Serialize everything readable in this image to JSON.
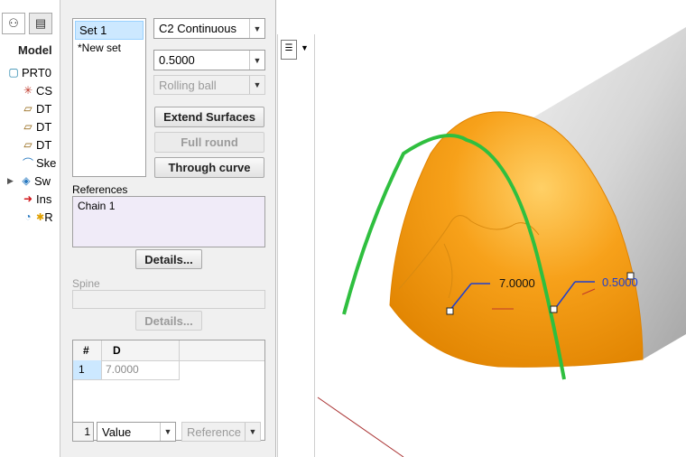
{
  "tree": {
    "title": "Model",
    "items": [
      {
        "label": "PRT0",
        "icon": "part-icon"
      },
      {
        "label": "CS",
        "icon": "csys-icon"
      },
      {
        "label": "DT",
        "icon": "datum-plane-icon"
      },
      {
        "label": "DT",
        "icon": "datum-plane-icon"
      },
      {
        "label": "DT",
        "icon": "datum-plane-icon"
      },
      {
        "label": "Ske",
        "icon": "sketch-icon"
      },
      {
        "label": "Sw",
        "icon": "sweep-icon"
      },
      {
        "label": "Ins",
        "icon": "insert-arrow-icon"
      },
      {
        "label": "R",
        "icon": "round-icon"
      }
    ]
  },
  "panel": {
    "sets": [
      "Set 1",
      "*New set"
    ],
    "continuity": "C2 Continuous",
    "radius_value": "0.5000",
    "rolling_ball": "Rolling ball",
    "extend_surfaces": "Extend Surfaces",
    "full_round": "Full round",
    "through_curve": "Through curve",
    "references_label": "References",
    "references": [
      "Chain 1"
    ],
    "details_label": "Details...",
    "spine_label": "Spine",
    "details2_label": "Details...",
    "table": {
      "headers": [
        "#",
        "D"
      ],
      "rows": [
        {
          "num": "1",
          "value": "7.0000"
        }
      ]
    },
    "bottom_num": "1",
    "value_option": "Value",
    "reference_option": "Reference"
  },
  "viewport": {
    "dim1": "7.0000",
    "dim2": "0.5000"
  }
}
